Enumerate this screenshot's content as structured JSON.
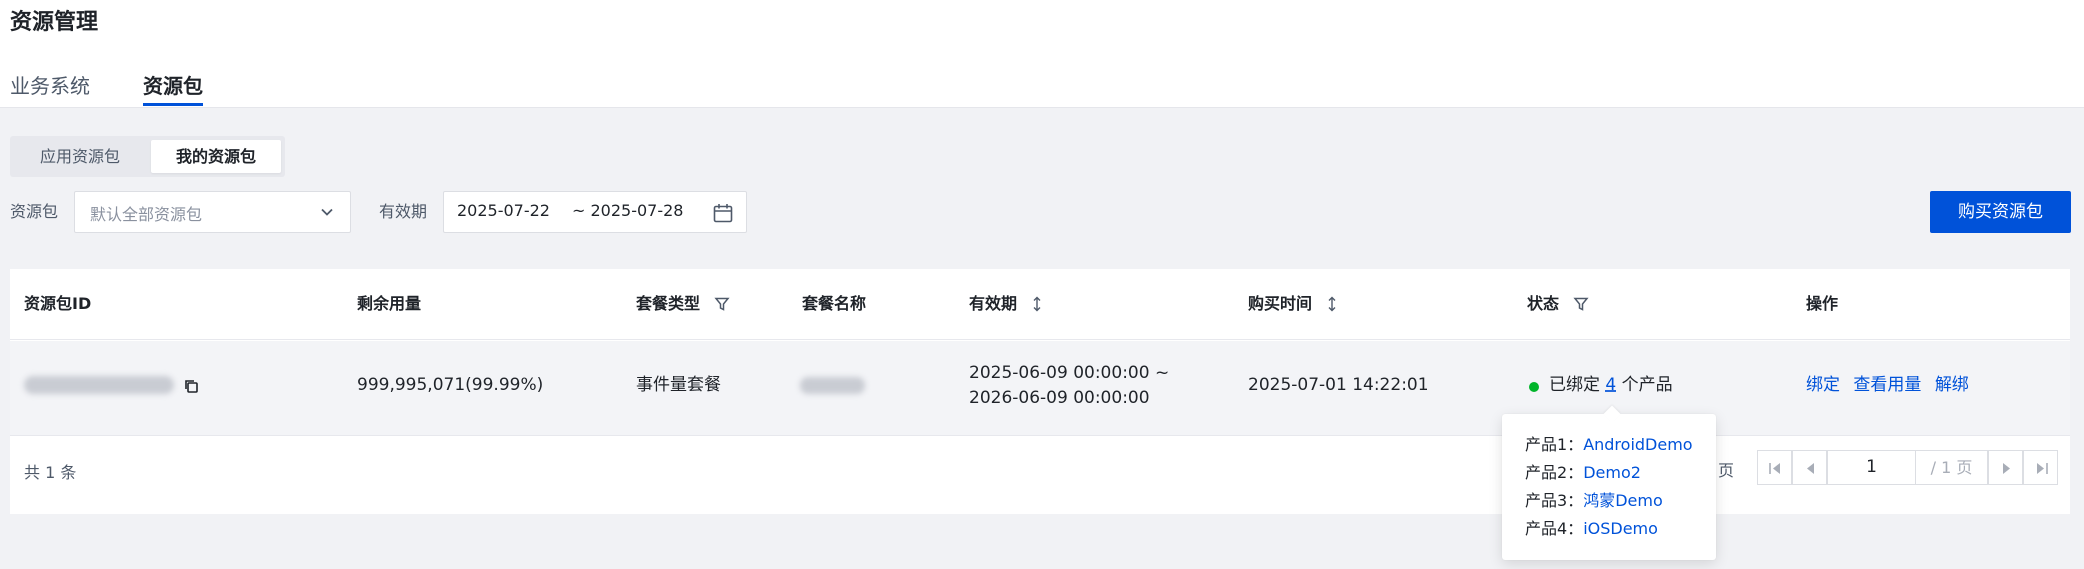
{
  "page": {
    "title": "资源管理"
  },
  "main_tabs": [
    {
      "label": "业务系统"
    },
    {
      "label": "资源包"
    }
  ],
  "segments": [
    {
      "label": "应用资源包"
    },
    {
      "label": "我的资源包"
    }
  ],
  "filters": {
    "package_label": "资源包",
    "package_placeholder": "默认全部资源包",
    "validity_label": "有效期",
    "date_start": "2025-07-22",
    "date_end": "~ 2025-07-28"
  },
  "buy_button": "购买资源包",
  "table": {
    "columns": [
      {
        "label": "资源包ID"
      },
      {
        "label": "剩余用量"
      },
      {
        "label": "套餐类型"
      },
      {
        "label": "套餐名称"
      },
      {
        "label": "有效期"
      },
      {
        "label": "购买时间"
      },
      {
        "label": "状态"
      },
      {
        "label": "操作"
      }
    ],
    "rows": [
      {
        "remaining": "999,995,071(99.99%)",
        "type": "事件量套餐",
        "validity_line1": "2025-06-09 00:00:00 ~",
        "validity_line2": "2026-06-09 00:00:00",
        "purchased": "2025-07-01 14:22:01",
        "status_prefix": "已绑定",
        "status_count": "4",
        "status_suffix": "个产品",
        "status_color": "#00b42a",
        "actions": [
          "绑定",
          "查看用量",
          "解绑"
        ]
      }
    ],
    "total_text": "共 1 条"
  },
  "pagination": {
    "page_suffix": "页",
    "current": "1",
    "total": "/ 1 页"
  },
  "popover": {
    "items": [
      {
        "label": "产品1：",
        "value": "AndroidDemo"
      },
      {
        "label": "产品2：",
        "value": "Demo2"
      },
      {
        "label": "产品3：",
        "value": "鸿蒙Demo"
      },
      {
        "label": "产品4：",
        "value": "iOSDemo"
      }
    ]
  },
  "colors": {
    "primary": "#0052d9",
    "success": "#00b42a",
    "background": "#f1f2f5"
  }
}
